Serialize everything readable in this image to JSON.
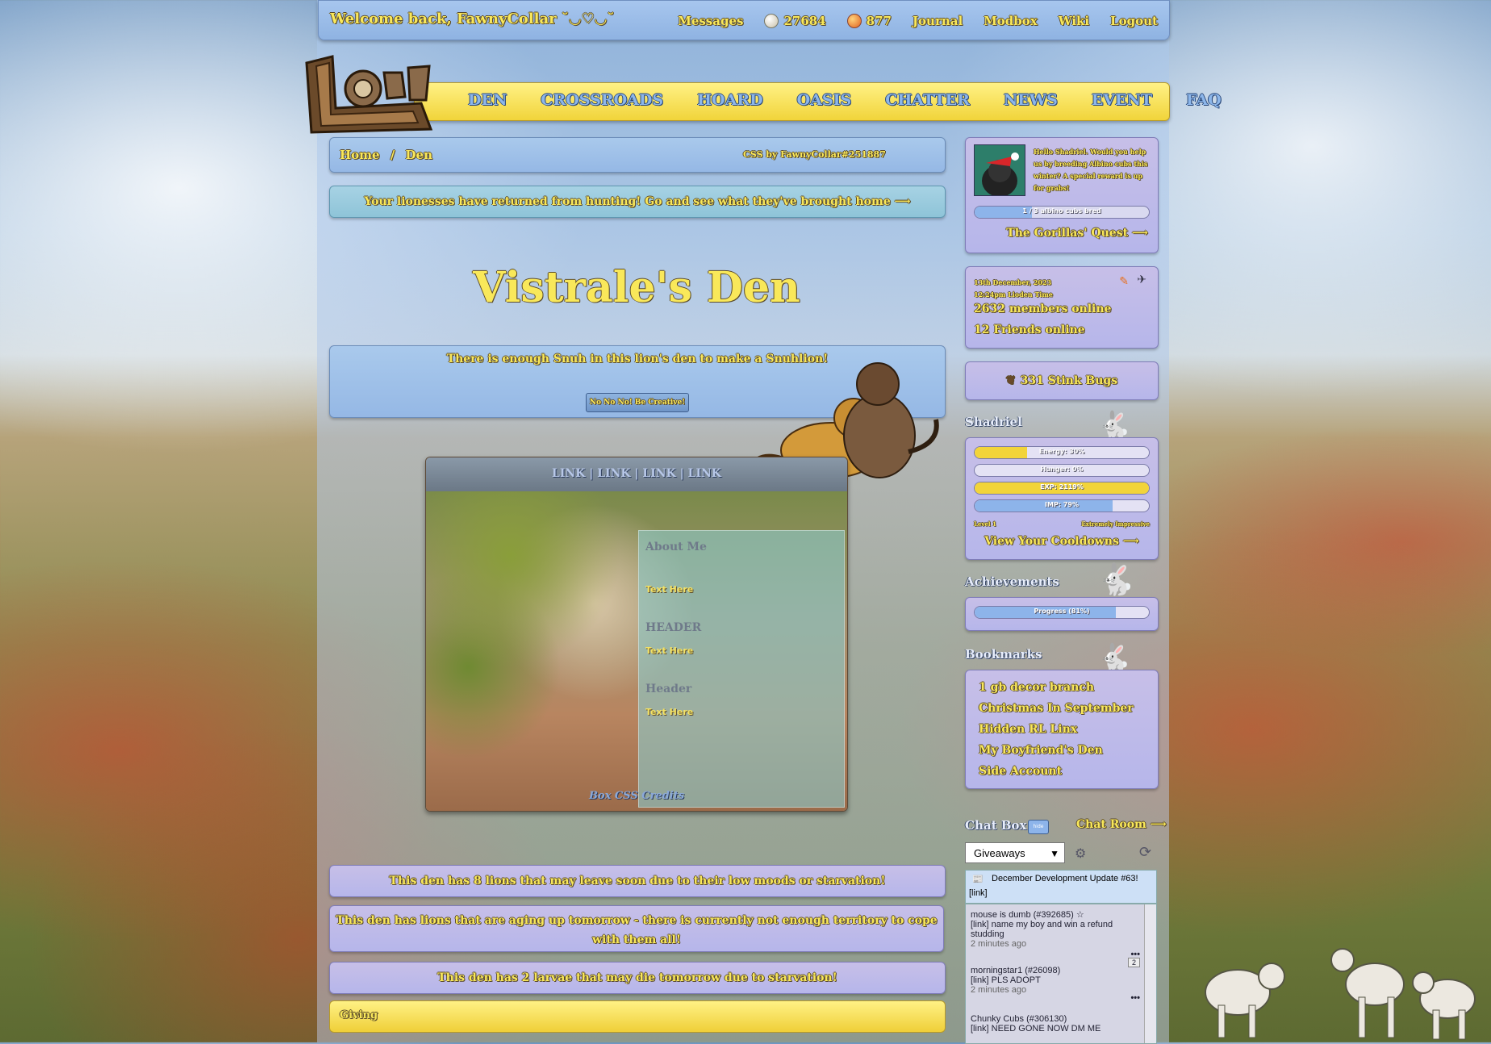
{
  "topbar": {
    "welcome": "Welcome back, FawnyCollar ˘◡♡◡˘",
    "messages": "Messages",
    "gold": "27684",
    "gems": "877",
    "journal": "Journal",
    "modbox": "Modbox",
    "wiki": "Wiki",
    "logout": "Logout"
  },
  "nav": [
    "DEN",
    "CROSSROADS",
    "HOARD",
    "OASIS",
    "CHATTER",
    "NEWS",
    "EVENT",
    "FAQ"
  ],
  "breadcrumb": {
    "home": "Home",
    "sep": "/",
    "current": "Den",
    "css_credit": "CSS by FawnyCollar#251887"
  },
  "hunting": "Your lionesses have returned from hunting! Go and see what they've brought home ⟶",
  "den_title": "Vistrale's Den",
  "snuh": {
    "text": "There is enough Snuh in this lion's den to make a Snuhlion!",
    "button": "No No No! Be Creative!"
  },
  "box": {
    "links": "LINK | LINK | LINK | LINK",
    "about_me": "About Me",
    "text1": "Text Here",
    "header1": "HEADER",
    "text2": "Text Here",
    "header2": "Header",
    "text3": "Text Here",
    "credit": "Box CSS Credits"
  },
  "warnings": [
    "This den has 8 lions that may leave soon due to their low moods or starvation!",
    "This den has lions that are aging up tomorrow - there is currently not enough territory to cope with them all!",
    "This den has 2 larvae that may die tomorrow due to starvation!"
  ],
  "giving": "Giving",
  "quest": {
    "text": "Hello Shadriel. Would you help us by breeding Albino cubs this winter? A special reward is up for grabs!",
    "progress_label": "1 / 3 albino cubs bred",
    "progress_fraction": 0.33,
    "link": "The Gorillas' Quest ⟶"
  },
  "time": {
    "date": "13th December, 2023",
    "clock": "12:24pm Lioden Time",
    "members": "2632 members online",
    "friends": "12 Friends online"
  },
  "stinkbugs": "331 Stink Bugs",
  "stats": {
    "title": "Shadriel",
    "energy": {
      "label": "Energy: 30%",
      "value": 0.3
    },
    "hunger": {
      "label": "Hunger: 0%",
      "value": 0.0
    },
    "exp": {
      "label": "EXP: 2119%",
      "value": 1.0
    },
    "imp": {
      "label": "IMP: 79%",
      "value": 0.79
    },
    "level": "Level 1",
    "impressive": "Extremely Impressive",
    "cooldowns": "View Your Cooldowns ⟶"
  },
  "achievements": {
    "title": "Achievements",
    "label": "Progress (81%)",
    "value": 0.81
  },
  "bookmarks": {
    "title": "Bookmarks",
    "items": [
      "1 gb decor branch",
      "Christmas In September",
      "Hidden RL Linx",
      "My Boyfriend's Den",
      "Side Account"
    ]
  },
  "chat": {
    "title": "Chat Box",
    "badge": "hide",
    "room": "Chat Room ⟶",
    "select": "Giveaways",
    "news_title": "December Development Update #63!",
    "news_link": "[link]",
    "messages": [
      {
        "name": "mouse is dumb (#392685) ☆",
        "text": "[link] name my boy and win a refund studding",
        "time": "2 minutes ago"
      },
      {
        "name": "morningstar1 (#26098)",
        "text": "[link] PLS ADOPT",
        "time": "2 minutes ago",
        "count": "2"
      },
      {
        "name": "Chunky Cubs (#306130)",
        "text": "[link] NEED GONE NOW DM ME",
        "time": ""
      }
    ]
  },
  "colors": {
    "gold": "#f9e85a",
    "nav_bg": "#f1d43a",
    "panel_blue": "#a9c9ec",
    "panel_lilac": "#c7bfe8"
  }
}
